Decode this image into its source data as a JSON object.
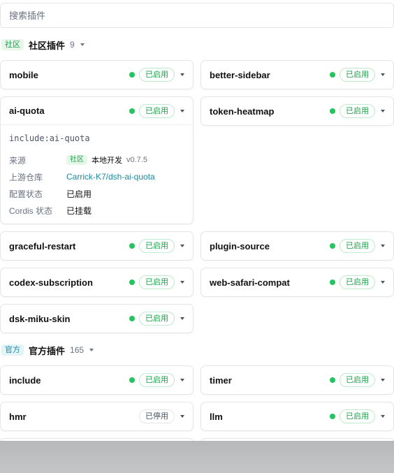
{
  "search": {
    "placeholder": "搜索插件",
    "value": ""
  },
  "community": {
    "tag": "社区",
    "title": "社区插件",
    "count": "9",
    "plugins": [
      {
        "name": "mobile",
        "status": "已启用"
      },
      {
        "name": "better-sidebar",
        "status": "已启用"
      },
      {
        "name": "ai-quota",
        "status": "已启用"
      },
      {
        "name": "token-heatmap",
        "status": "已启用"
      },
      {
        "name": "graceful-restart",
        "status": "已启用"
      },
      {
        "name": "plugin-source",
        "status": "已启用"
      },
      {
        "name": "codex-subscription",
        "status": "已启用"
      },
      {
        "name": "web-safari-compat",
        "status": "已启用"
      },
      {
        "name": "dsk-miku-skin",
        "status": "已启用"
      }
    ],
    "detail": {
      "code": "include:ai-quota",
      "source_label": "来源",
      "source_tag": "社区",
      "source_local": "本地开发",
      "source_version": "v0.7.5",
      "repo_label": "上游仓库",
      "repo_value": "Carrick-K7/dsh-ai-quota",
      "config_label": "配置状态",
      "config_value": "已启用",
      "cordis_label": "Cordis 状态",
      "cordis_value": "已挂载"
    }
  },
  "official": {
    "tag": "官方",
    "title": "官方插件",
    "count": "165",
    "plugins": [
      {
        "name": "include",
        "status": "已启用"
      },
      {
        "name": "timer",
        "status": "已启用"
      },
      {
        "name": "hmr",
        "status": "已停用"
      },
      {
        "name": "llm",
        "status": "已启用"
      }
    ]
  },
  "colors": {
    "enabled": "#22c55e",
    "community_accent": "#1aa34a",
    "official_accent": "#1b8aa0"
  }
}
